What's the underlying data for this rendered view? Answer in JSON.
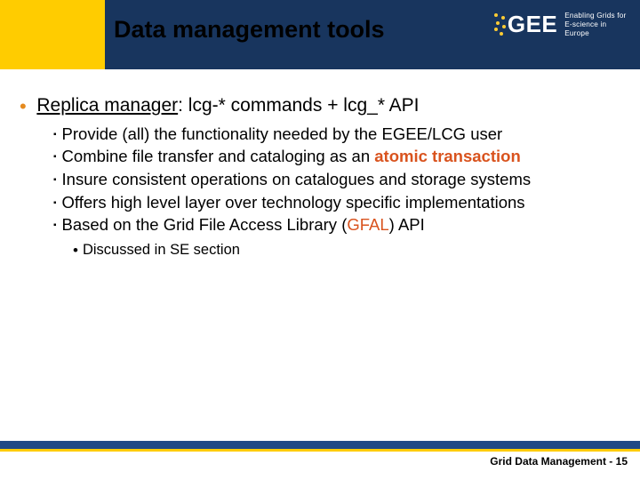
{
  "header": {
    "title": "Data management tools",
    "logo_text": "GEE",
    "logo_tag1": "Enabling Grids for",
    "logo_tag2": "E-science in Europe"
  },
  "bullet": {
    "l1_prefix": "Replica manager",
    "l1_rest": ": lcg-* commands + lcg_* API",
    "subs": {
      "s1": "Provide (all) the functionality needed by the EGEE/LCG user",
      "s2a": "Combine file transfer and cataloging as an ",
      "s2b_bold": "atomic transaction",
      "s3": "Insure consistent operations on catalogues and storage systems",
      "s4": "Offers high level layer over technology specific implementations",
      "s5a": "Based on the Grid File Access Library (",
      "s5b_acc": "GFAL",
      "s5c": ")  API"
    },
    "subsub": {
      "t1": "Discussed in SE section"
    }
  },
  "footer": {
    "text": "Grid Data Management  -  15"
  }
}
